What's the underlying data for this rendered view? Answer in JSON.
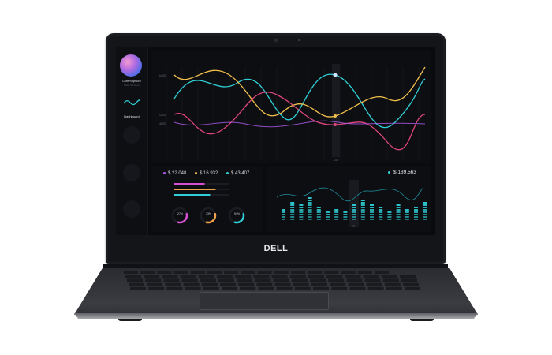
{
  "brand": {
    "logo_text": "DELL"
  },
  "screen": {
    "sidebar": {
      "profile_name": "Lorem Ipsum",
      "profile_subtitle": "Dolor Sit Amet",
      "active_item_label": "Dashboard",
      "inactive_items": [
        "",
        "",
        "",
        ""
      ]
    },
    "top_chart": {
      "y_tick_labels": [
        "44.43",
        "22.03",
        "16.03"
      ],
      "highlight_label": "20",
      "series_colors": [
        "#2fd0d6",
        "#f2c04a",
        "#e0457e",
        "#b05cf0"
      ]
    },
    "bottom_left": {
      "metrics": [
        {
          "value": "$ 22.048",
          "color": "#b05cf0"
        },
        {
          "value": "$ 16.932",
          "color": "#f2c04a"
        },
        {
          "value": "$ 43.407",
          "color": "#2fd0d6"
        }
      ],
      "progress": [
        {
          "fraction": 0.55,
          "color": "#d64fd0"
        },
        {
          "fraction": 0.75,
          "color": "#f2a24a"
        },
        {
          "fraction": 0.65,
          "color": "#2fd0d6"
        }
      ],
      "donuts": [
        {
          "label": "27%",
          "fraction": 0.27,
          "color": "#d64fd0"
        },
        {
          "label": "13%",
          "fraction": 0.13,
          "color": "#f2a24a"
        },
        {
          "label": "54%",
          "fraction": 0.54,
          "color": "#2fd0d6"
        }
      ]
    },
    "bottom_right": {
      "metric_value": "$ 189.563",
      "bar_values": [
        0.45,
        0.7,
        0.55,
        0.85,
        0.5,
        0.35,
        0.45,
        0.35,
        0.55,
        0.75,
        0.6,
        0.5,
        0.35,
        0.55,
        0.4,
        0.5,
        0.65
      ],
      "highlight_label": "20"
    }
  }
}
